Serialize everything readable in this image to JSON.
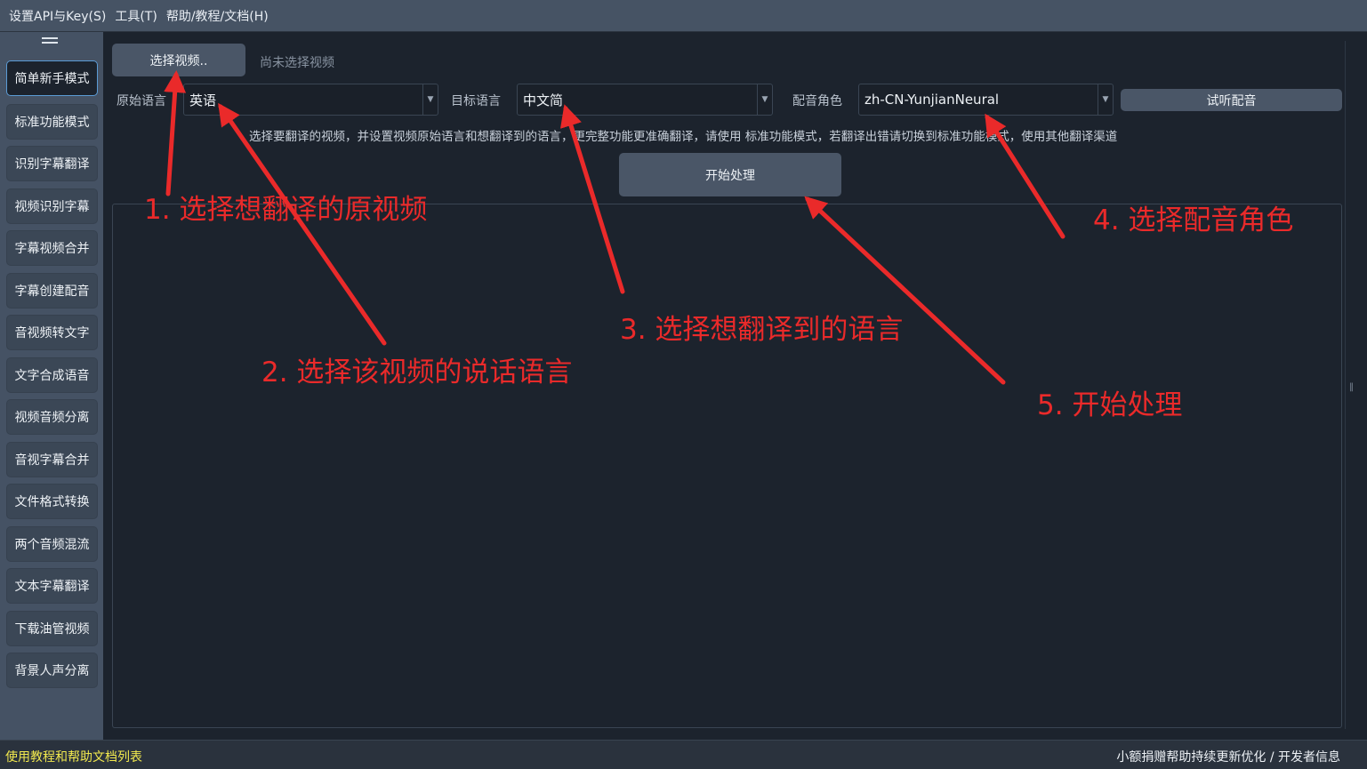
{
  "menu": [
    "设置API与Key(S)",
    "工具(T)",
    "帮助/教程/文档(H)"
  ],
  "sidebar": {
    "items": [
      {
        "label": "简单新手模式",
        "active": true
      },
      {
        "label": "标准功能模式"
      },
      {
        "label": "识别字幕翻译"
      },
      {
        "label": "视频识别字幕"
      },
      {
        "label": "字幕视频合并"
      },
      {
        "label": "字幕创建配音"
      },
      {
        "label": "音视频转文字"
      },
      {
        "label": "文字合成语音"
      },
      {
        "label": "视频音频分离"
      },
      {
        "label": "音视字幕合并"
      },
      {
        "label": "文件格式转换"
      },
      {
        "label": "两个音频混流"
      },
      {
        "label": "文本字幕翻译"
      },
      {
        "label": "下载油管视频"
      },
      {
        "label": "背景人声分离"
      }
    ]
  },
  "main": {
    "select_video_button": "选择视频..",
    "video_status": "尚未选择视频",
    "source_language_label": "原始语言",
    "source_language_value": "英语",
    "target_language_label": "目标语言",
    "target_language_value": "中文简",
    "voice_role_label": "配音角色",
    "voice_role_value": "zh-CN-YunjianNeural",
    "preview_voice_button": "试听配音",
    "hint": "选择要翻译的视频，并设置视频原始语言和想翻译到的语言，更完整功能更准确翻译，请使用 标准功能模式，若翻译出错请切换到标准功能模式，使用其他翻译渠道",
    "start_button": "开始处理"
  },
  "status": {
    "left": "使用教程和帮助文档列表",
    "right": "小额捐赠帮助持续更新优化 / 开发者信息"
  },
  "annotations": [
    "1. 选择想翻译的原视频",
    "2. 选择该视频的说话语言",
    "3. 选择想翻译到的语言",
    "4. 选择配音角色",
    "5. 开始处理"
  ],
  "colors": {
    "annotation": "#ea2a2a",
    "status_link": "#f2e94e",
    "active_border": "#5b9bd5"
  }
}
